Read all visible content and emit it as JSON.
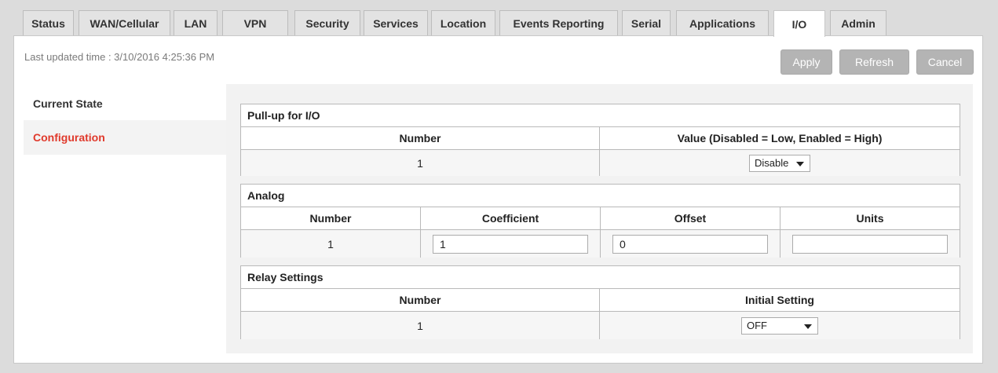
{
  "tabs": [
    {
      "label": "Status"
    },
    {
      "label": "WAN/Cellular"
    },
    {
      "label": "LAN"
    },
    {
      "label": "VPN"
    },
    {
      "label": "Security"
    },
    {
      "label": "Services"
    },
    {
      "label": "Location"
    },
    {
      "label": "Events Reporting"
    },
    {
      "label": "Serial"
    },
    {
      "label": "Applications"
    },
    {
      "label": "I/O",
      "active": true
    },
    {
      "label": "Admin"
    }
  ],
  "header": {
    "last_updated": "Last updated time : 3/10/2016 4:25:36 PM",
    "apply_label": "Apply",
    "refresh_label": "Refresh",
    "cancel_label": "Cancel"
  },
  "sidebar": {
    "items": [
      {
        "label": "Current State"
      },
      {
        "label": "Configuration",
        "active": true
      }
    ]
  },
  "pullup": {
    "title": "Pull-up for I/O",
    "col_number": "Number",
    "col_value": "Value (Disabled = Low, Enabled = High)",
    "row_number": "1",
    "row_value": "Disable"
  },
  "analog": {
    "title": "Analog",
    "col_number": "Number",
    "col_coefficient": "Coefficient",
    "col_offset": "Offset",
    "col_units": "Units",
    "row_number": "1",
    "coefficient_value": "1",
    "offset_value": "0",
    "units_value": ""
  },
  "relay": {
    "title": "Relay Settings",
    "col_number": "Number",
    "col_initial": "Initial Setting",
    "row_number": "1",
    "initial_value": "OFF"
  }
}
